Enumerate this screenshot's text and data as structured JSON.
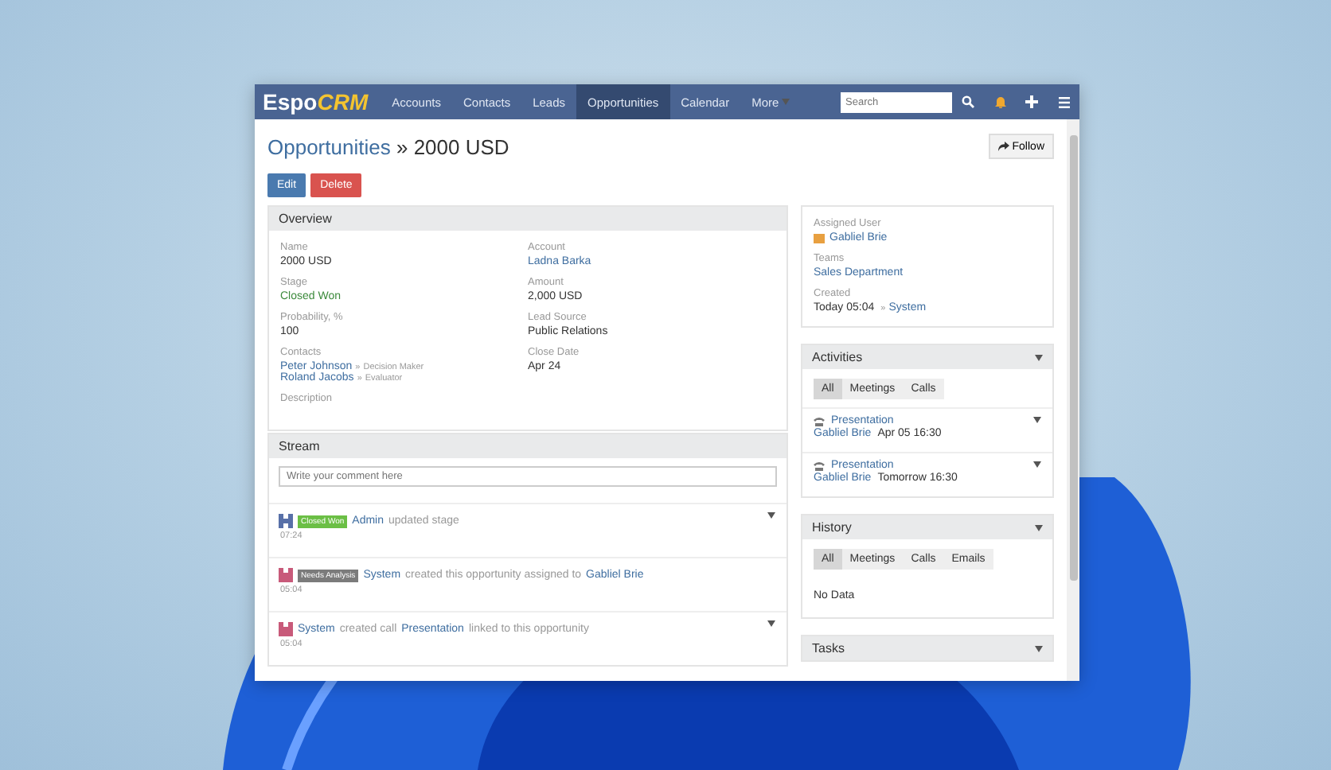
{
  "navbar": {
    "logo": [
      "Espo",
      "CRM"
    ],
    "items": [
      {
        "label": "Accounts",
        "selected": false
      },
      {
        "label": "Contacts",
        "selected": false
      },
      {
        "label": "Leads",
        "selected": false
      },
      {
        "label": "Opportunities",
        "selected": true
      },
      {
        "label": "Calendar",
        "selected": false
      },
      {
        "label": "More",
        "selected": false
      }
    ],
    "search": {
      "placeholder": "Search"
    }
  },
  "header": {
    "breadcrumb": "Opportunities",
    "separator": "»",
    "title": "2000 USD",
    "follow": "Follow",
    "buttons": [
      {
        "label": "Edit",
        "kind": "primary"
      },
      {
        "label": "Delete",
        "kind": "danger"
      }
    ]
  },
  "overview": {
    "title": "Overview",
    "columns": [
      [
        {
          "label": "Name",
          "kind": "text",
          "value": "2000 USD"
        },
        {
          "label": "Stage",
          "kind": "stage",
          "value": "Closed Won"
        },
        {
          "label": "Probability, %",
          "kind": "text",
          "value": "100"
        },
        {
          "label": "Contacts",
          "kind": "contacts",
          "contacts": [
            {
              "name": "Peter Johnson",
              "separator": "»",
              "role": "Decision Maker"
            },
            {
              "name": "Roland Jacobs",
              "separator": "»",
              "role": "Evaluator"
            }
          ]
        },
        {
          "label": "Description",
          "kind": "empty"
        }
      ],
      [
        {
          "label": "Account",
          "kind": "link",
          "value": "Ladna Barka"
        },
        {
          "label": "Amount",
          "kind": "text",
          "value": "2,000 USD"
        },
        {
          "label": "Lead Source",
          "kind": "text",
          "value": "Public Relations"
        },
        {
          "label": "Close Date",
          "kind": "text",
          "value": "Apr 24"
        }
      ]
    ]
  },
  "stream": {
    "title": "Stream",
    "placeholder": "Write your comment here",
    "entries": [
      {
        "kind": "admin",
        "badge": {
          "text": "Closed Won",
          "color": "#6bbf45"
        },
        "parts": [
          {
            "text": "Admin",
            "link": true
          },
          {
            "text": "updated stage",
            "link": false
          }
        ],
        "time": "07:24",
        "menu": true
      },
      {
        "kind": "system",
        "badge": {
          "text": "Needs Analysis",
          "color": "#7b7b7b"
        },
        "parts": [
          {
            "text": "System",
            "link": true
          },
          {
            "text": "created this opportunity assigned to",
            "link": false
          },
          {
            "text": "Gabliel Brie",
            "link": true
          }
        ],
        "time": "05:04",
        "menu": false
      },
      {
        "kind": "system",
        "parts": [
          {
            "text": "System",
            "link": true
          },
          {
            "text": "created call",
            "link": false
          },
          {
            "text": "Presentation",
            "link": true
          },
          {
            "text": "linked to this opportunity",
            "link": false
          }
        ],
        "time": "05:04",
        "menu": true
      }
    ]
  },
  "side": {
    "assigned_user": {
      "label": "Assigned User",
      "value": "Gabliel Brie"
    },
    "teams": {
      "label": "Teams",
      "value": "Sales Department"
    },
    "created": {
      "label": "Created",
      "value": "Today 05:04",
      "separator": "»",
      "by": "System"
    }
  },
  "activities": {
    "title": "Activities",
    "tabs": [
      {
        "label": "All",
        "selected": true
      },
      {
        "label": "Meetings",
        "selected": false
      },
      {
        "label": "Calls",
        "selected": false
      }
    ],
    "items": [
      {
        "title": "Presentation",
        "user": "Gabliel Brie",
        "date": "Apr 05 16:30"
      },
      {
        "title": "Presentation",
        "user": "Gabliel Brie",
        "date": "Tomorrow 16:30"
      }
    ]
  },
  "history": {
    "title": "History",
    "tabs": [
      {
        "label": "All",
        "selected": true
      },
      {
        "label": "Meetings",
        "selected": false
      },
      {
        "label": "Calls",
        "selected": false
      },
      {
        "label": "Emails",
        "selected": false
      }
    ],
    "empty": "No Data"
  },
  "tasks": {
    "title": "Tasks"
  }
}
